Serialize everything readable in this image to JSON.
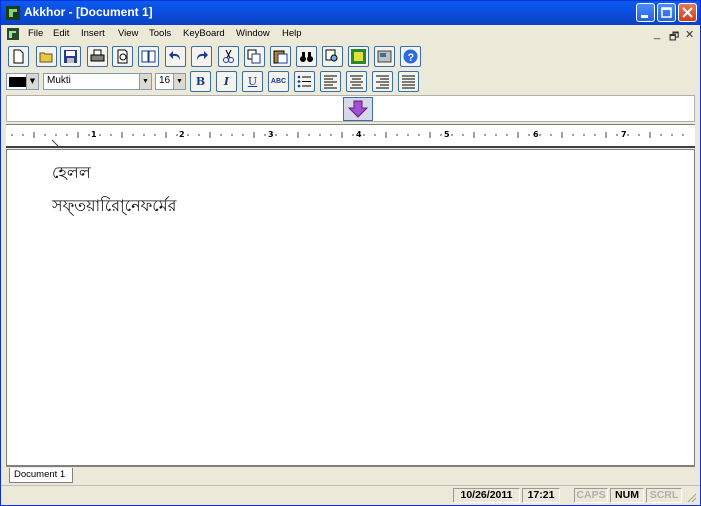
{
  "window": {
    "title": "Akkhor - [Document 1]"
  },
  "menu": {
    "items": [
      "File",
      "Edit",
      "Insert",
      "View",
      "Tools",
      "KeyBoard",
      "Window",
      "Help"
    ],
    "mdi_controls": [
      "_",
      "🗗",
      "✕"
    ]
  },
  "toolbar": {
    "buttons": [
      "new",
      "open",
      "save",
      "print",
      "print-preview",
      "spelling",
      "undo",
      "redo",
      "cut",
      "copy",
      "paste",
      "find",
      "replace",
      "keyboard-layout",
      "settings",
      "help"
    ]
  },
  "format": {
    "font_name": "Mukti",
    "font_size": "16",
    "text_color": "#000000",
    "bold_label": "B",
    "italic_label": "I",
    "underline_label": "U",
    "strike_label": "ABC"
  },
  "ruler": {
    "numbers": [
      "1",
      "2",
      "3",
      "4",
      "5",
      "6",
      "7"
    ]
  },
  "document": {
    "lines": [
      "হেলল",
      "সফ্তয়ারোি্নেফর্মের"
    ]
  },
  "tabs": {
    "doc_tab": "Document 1"
  },
  "status": {
    "date": "10/26/2011",
    "time": "17:21",
    "caps": "CAPS",
    "num": "NUM",
    "scrl": "SCRL"
  }
}
